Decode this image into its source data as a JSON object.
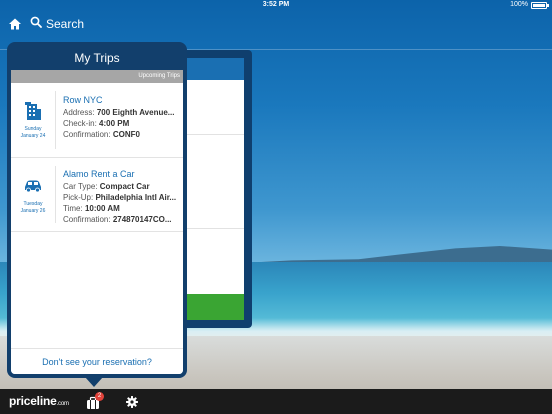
{
  "status_bar": {
    "time": "3:52 PM",
    "battery": "100%"
  },
  "top_nav": {
    "search_label": "Search",
    "home_icon": "home-icon",
    "search_icon": "search-icon"
  },
  "popover": {
    "title": "My Trips",
    "section_label": "Upcoming Trips",
    "trips": [
      {
        "icon": "hotel-icon",
        "date_line1": "Sunday",
        "date_line2": "January 24",
        "name": "Row NYC",
        "rows": [
          {
            "label": "Address:",
            "value": "700 Eighth Avenue..."
          },
          {
            "label": "Check-in:",
            "value": "4:00 PM"
          },
          {
            "label": "Confirmation:",
            "value": "CONF0"
          }
        ]
      },
      {
        "icon": "car-icon",
        "date_line1": "Tuesday",
        "date_line2": "January 26",
        "name": "Alamo Rent a Car",
        "rows": [
          {
            "label": "Car Type:",
            "value": "Compact Car"
          },
          {
            "label": "Pick-Up:",
            "value": "Philadelphia Intl Air..."
          },
          {
            "label": "Time:",
            "value": "10:00 AM"
          },
          {
            "label": "Confirmation:",
            "value": "274870147CO..."
          }
        ]
      }
    ],
    "footer_link": "Don't see your reservation?"
  },
  "toolbar": {
    "brand": "priceline",
    "brand_suffix": ".com",
    "trips_badge": "2",
    "trips_icon": "suitcase-icon",
    "settings_icon": "gear-icon"
  },
  "colors": {
    "accent": "#1a6fb2",
    "popover_frame": "#123f6c",
    "section_bar": "#a6a6a6",
    "toolbar": "#1b1b1b",
    "badge": "#e0423a",
    "green_button": "#3aa533"
  }
}
